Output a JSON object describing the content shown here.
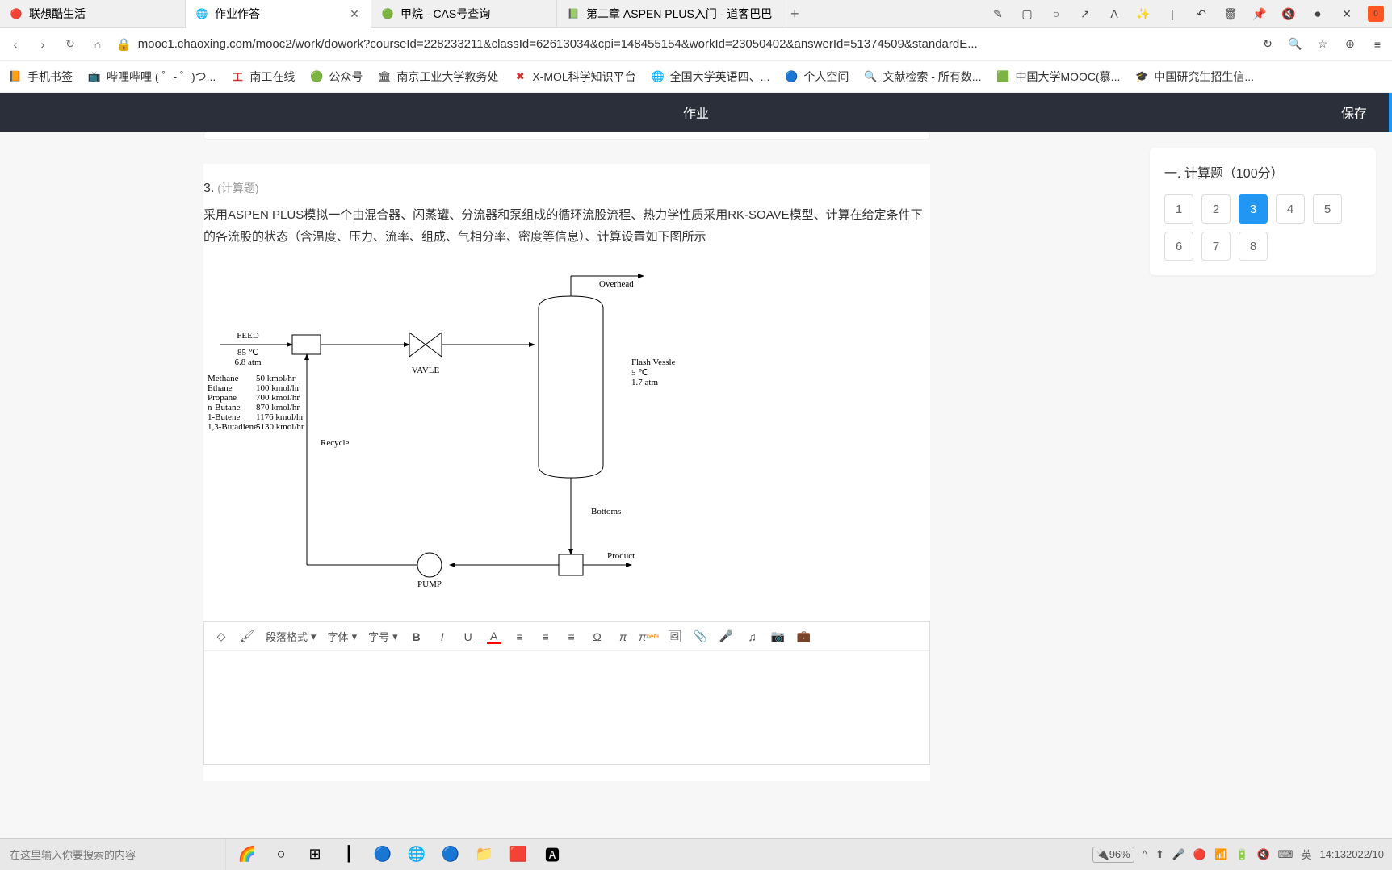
{
  "tabs": [
    {
      "title": "联想酷生活",
      "icon": "🔴"
    },
    {
      "title": "作业作答",
      "icon": "🌐",
      "active": true
    },
    {
      "title": "甲烷 - CAS号查询",
      "icon": "🟢"
    },
    {
      "title": "第二章 ASPEN PLUS入门 - 道客巴巴",
      "icon": "📗"
    }
  ],
  "tool_icons": {
    "edit": "✎",
    "square": "▢",
    "circle": "○",
    "arrow": "↗",
    "text": "A",
    "fx": "✨",
    "divider": "|",
    "undo": "↶",
    "trash": "🗑",
    "pin": "📌",
    "red1": "🔇",
    "red2": "⏺",
    "x": "✕",
    "orange": "0"
  },
  "nav": {
    "back": "‹",
    "fwd": "›",
    "reload": "↻",
    "home": "⌂"
  },
  "url": {
    "lock": "🔒",
    "text": "mooc1.chaoxing.com/mooc2/work/dowork?courseId=228233211&classId=62613034&cpi=148455154&workId=23050402&answerId=51374509&standardE..."
  },
  "right_nav": {
    "reload": "↻",
    "search": "🔍",
    "star": "☆",
    "ext": "⊕",
    "menu": "≡"
  },
  "bookmarks": [
    {
      "icon": "📙",
      "label": "手机书签"
    },
    {
      "icon": "📺",
      "label": "哔哩哔哩 ( ゜- ゜)つ..."
    },
    {
      "icon": "工",
      "label": "南工在线",
      "color": "#d32f2f"
    },
    {
      "icon": "🟢",
      "label": "公众号"
    },
    {
      "icon": "🏛",
      "label": "南京工业大学教务处"
    },
    {
      "icon": "✖",
      "label": "X-MOL科学知识平台"
    },
    {
      "icon": "🌐",
      "label": "全国大学英语四、..."
    },
    {
      "icon": "🔵",
      "label": "个人空间"
    },
    {
      "icon": "🔍",
      "label": "文献检索 - 所有数..."
    },
    {
      "icon": "🟩",
      "label": "中国大学MOOC(慕..."
    },
    {
      "icon": "🎓",
      "label": "中国研究生招生信..."
    }
  ],
  "header": {
    "title": "作业",
    "save": "保存"
  },
  "question": {
    "num": "3.",
    "type": "(计算题)",
    "text": "采用ASPEN PLUS模拟一个由混合器、闪蒸罐、分流器和泵组成的循环流股流程、热力学性质采用RK-SOAVE模型、计算在给定条件下的各流股的状态（含温度、压力、流率、组成、气相分率、密度等信息）、计算设置如下图所示"
  },
  "diagram": {
    "feed": "FEED",
    "feed_t": "85 ℃",
    "feed_p": "6.8 atm",
    "comps": [
      {
        "n": "Methane",
        "f": "50 kmol/hr"
      },
      {
        "n": "Ethane",
        "f": "100 kmol/hr"
      },
      {
        "n": "Propane",
        "f": "700 kmol/hr"
      },
      {
        "n": "n-Butane",
        "f": "870 kmol/hr"
      },
      {
        "n": "1-Butene",
        "f": "1176 kmol/hr"
      },
      {
        "n": "1,3-Butadiene",
        "f": "5130 kmol/hr"
      }
    ],
    "valve": "VAVLE",
    "flash": "Flash Vessle",
    "flash_t": "5 ℃",
    "flash_p": "1.7 atm",
    "overhead": "Overhead",
    "bottoms": "Bottoms",
    "product": "Product",
    "pump": "PUMP",
    "recycle": "Recycle"
  },
  "editor": {
    "eraser": "◇",
    "brush": "🖌",
    "format": "段落格式",
    "font": "字体",
    "size": "字号",
    "bold": "B",
    "italic": "I",
    "underline": "U",
    "color": "A",
    "align_l": "≡",
    "align_c": "≡",
    "align_r": "≡",
    "omega": "Ω",
    "pi": "π",
    "pi_beta": "π",
    "img": "🖼",
    "attach": "📎",
    "mic": "🎤",
    "music": "♫",
    "camera": "📷",
    "bag": "💼"
  },
  "side": {
    "title": "一. 计算题（100分）",
    "nums": [
      "1",
      "2",
      "3",
      "4",
      "5",
      "6",
      "7",
      "8"
    ],
    "active": 2
  },
  "taskbar": {
    "search": "在这里输入你要搜索的内容",
    "battery": "96%",
    "up": "^",
    "ime": "英",
    "time": "14:13",
    "date": "2022/10"
  }
}
